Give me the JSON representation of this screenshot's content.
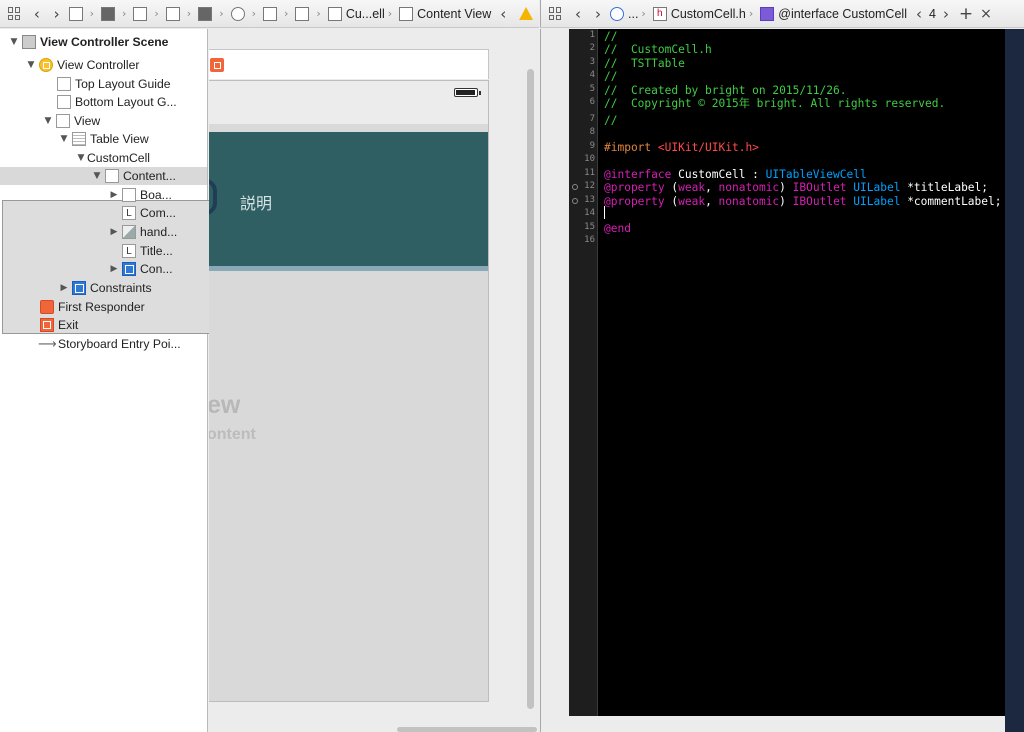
{
  "left_jumpbar": {
    "crumbs": [
      "Cu...ell",
      "Content View"
    ]
  },
  "right_jumpbar": {
    "crumbs": [
      "...",
      "CustomCell.h",
      "@interface CustomCell"
    ],
    "counter": "4"
  },
  "outline": {
    "scene_title": "View Controller Scene",
    "items": [
      {
        "label": "View Controller",
        "icon": "view-controller-icon"
      },
      {
        "label": "Top Layout Guide",
        "icon": "layout-guide-icon"
      },
      {
        "label": "Bottom Layout G...",
        "icon": "layout-guide-icon"
      },
      {
        "label": "View",
        "icon": "view-icon"
      },
      {
        "label": "Table View",
        "icon": "table-view-icon"
      },
      {
        "label": "CustomCell",
        "icon": "table-cell-icon"
      },
      {
        "label": "Content...",
        "icon": "content-view-icon"
      },
      {
        "label": "Boa...",
        "icon": "view-icon"
      },
      {
        "label": "Com...",
        "icon": "label-icon"
      },
      {
        "label": "hand...",
        "icon": "image-view-icon"
      },
      {
        "label": "Title...",
        "icon": "label-icon"
      },
      {
        "label": "Con...",
        "icon": "constraints-icon"
      },
      {
        "label": "Constraints",
        "icon": "constraints-icon"
      },
      {
        "label": "First Responder",
        "icon": "first-responder-icon"
      },
      {
        "label": "Exit",
        "icon": "exit-icon"
      },
      {
        "label": "Storyboard Entry Poi...",
        "icon": "entry-arrow-icon"
      }
    ]
  },
  "canvas": {
    "cell_description": "説明",
    "table_view_label": "ew",
    "table_view_sub": "ontent"
  },
  "code": {
    "line_numbers": [
      "1",
      "2",
      "3",
      "4",
      "5",
      "6",
      "7",
      "8",
      "9",
      "10",
      "11",
      "12",
      "13",
      "14",
      "15",
      "16"
    ],
    "lines": {
      "l1": "//",
      "l2": "//  CustomCell.h",
      "l3": "//  TSTTable",
      "l4": "//",
      "l5": "//  Created by bright on 2015/11/26.",
      "l6": "//  Copyright © 2015年 bright. All rights reserved.",
      "l7": "//",
      "l9_pre": "#import ",
      "l9_inc": "<UIKit/UIKit.h>",
      "l11_kw": "@interface",
      "l11_name": " CustomCell : ",
      "l11_type": "UITableViewCell",
      "prop_kw": "@property",
      "prop_attr_open": " (",
      "prop_weak": "weak",
      "prop_comma": ", ",
      "prop_nonatomic": "nonatomic",
      "prop_attr_close": ") ",
      "iboutlet": "IBOutlet",
      "uilabel": "UILabel",
      "l12_var": " *titleLabel;",
      "l13_var": " *commentLabel;",
      "l15": "@end"
    }
  },
  "colors": {
    "comment": "#41cc45",
    "keyword": "#d51fb5",
    "type": "#00a0ff",
    "include": "#ff4b4b",
    "preprocessor": "#e0843d",
    "cell_background": "#2f5e63"
  }
}
